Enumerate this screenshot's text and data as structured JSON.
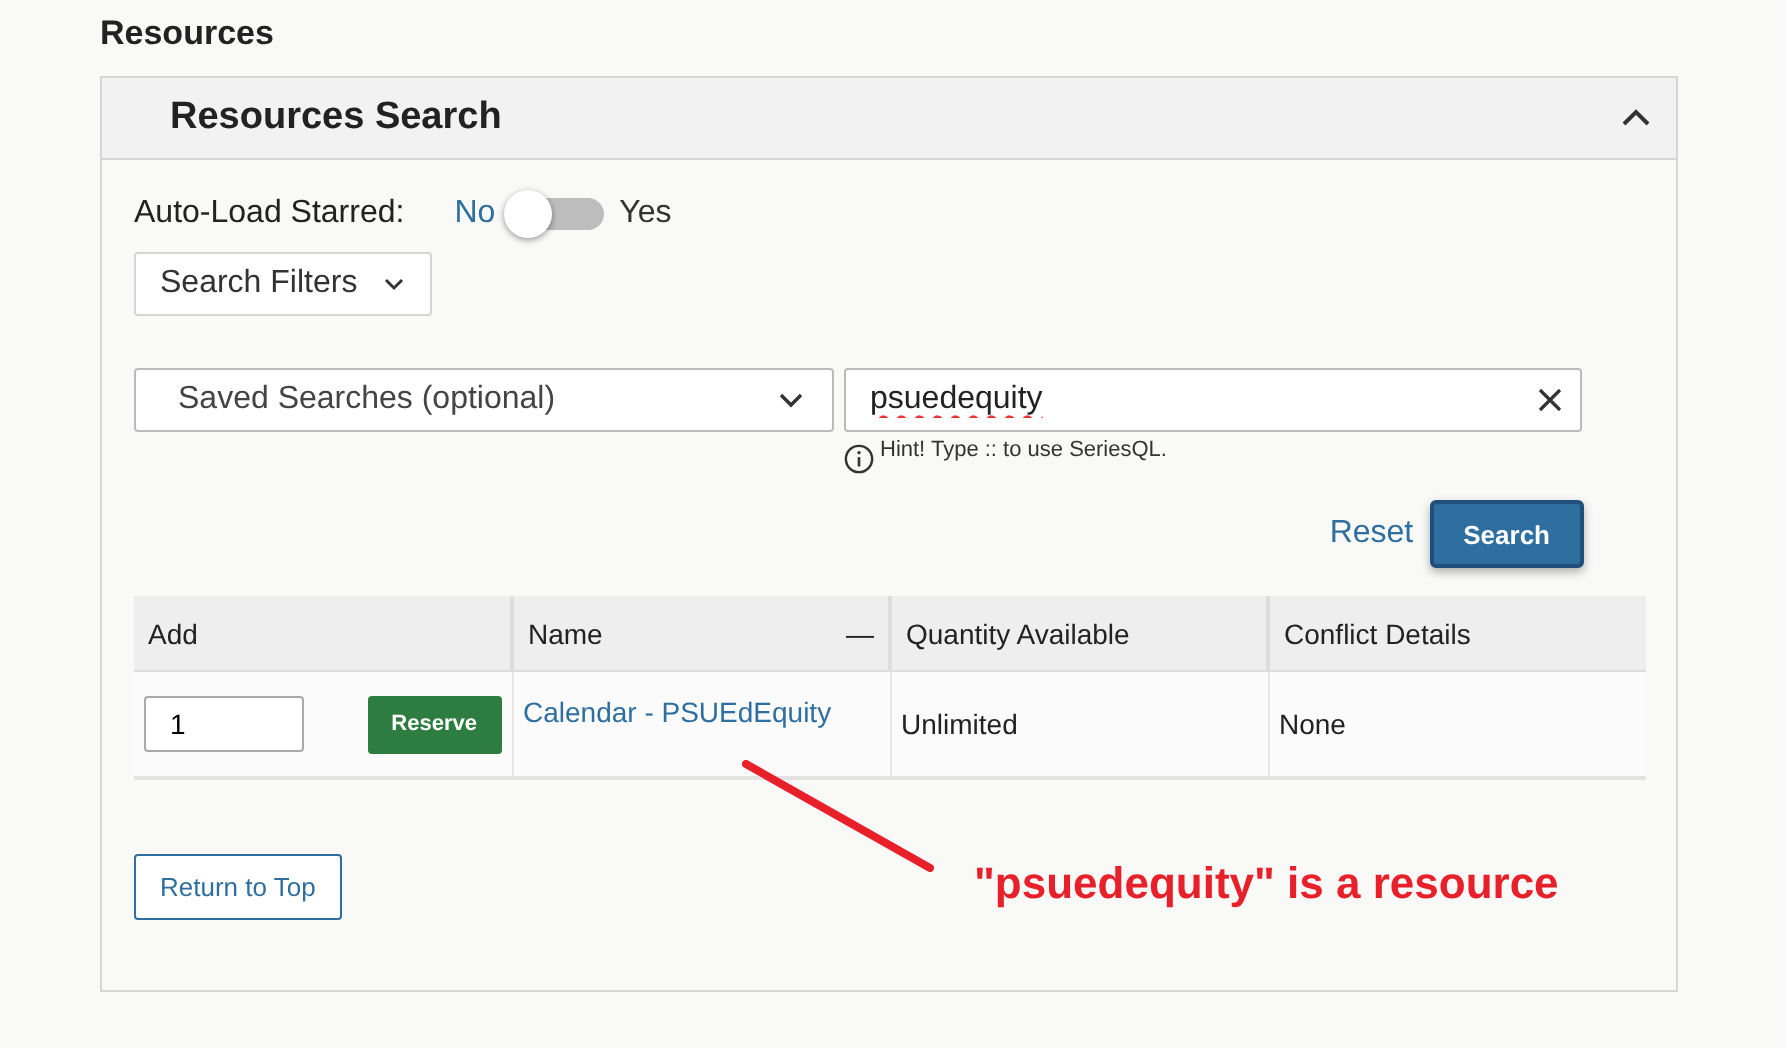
{
  "heading": "Resources",
  "panel": {
    "title": "Resources Search",
    "expanded": true
  },
  "auto_load": {
    "label": "Auto-Load Starred:",
    "off_label": "No",
    "on_label": "Yes",
    "on": false
  },
  "search_filters": {
    "label": "Search Filters"
  },
  "saved_searches": {
    "placeholder": "Saved Searches (optional)"
  },
  "search_field": {
    "value": "psuedequity",
    "hint": "Hint! Type :: to use SeriesQL."
  },
  "buttons": {
    "reset": "Reset",
    "search": "Search",
    "return_top": "Return to Top"
  },
  "table": {
    "columns": [
      {
        "label": "Add",
        "kind": "plain"
      },
      {
        "label": "Name",
        "kind": "collapse",
        "collapse_icon": "—"
      },
      {
        "label": "Quantity Available",
        "kind": "plain"
      },
      {
        "label": "Conflict Details",
        "kind": "plain"
      }
    ],
    "rows": [
      {
        "quantity": "1",
        "action": "Reserve",
        "name": "Calendar - PSUEdEquity",
        "available": "Unlimited",
        "conflicts": "None"
      }
    ]
  },
  "annotation": {
    "text": "\"psuedequity\" is a resource"
  }
}
